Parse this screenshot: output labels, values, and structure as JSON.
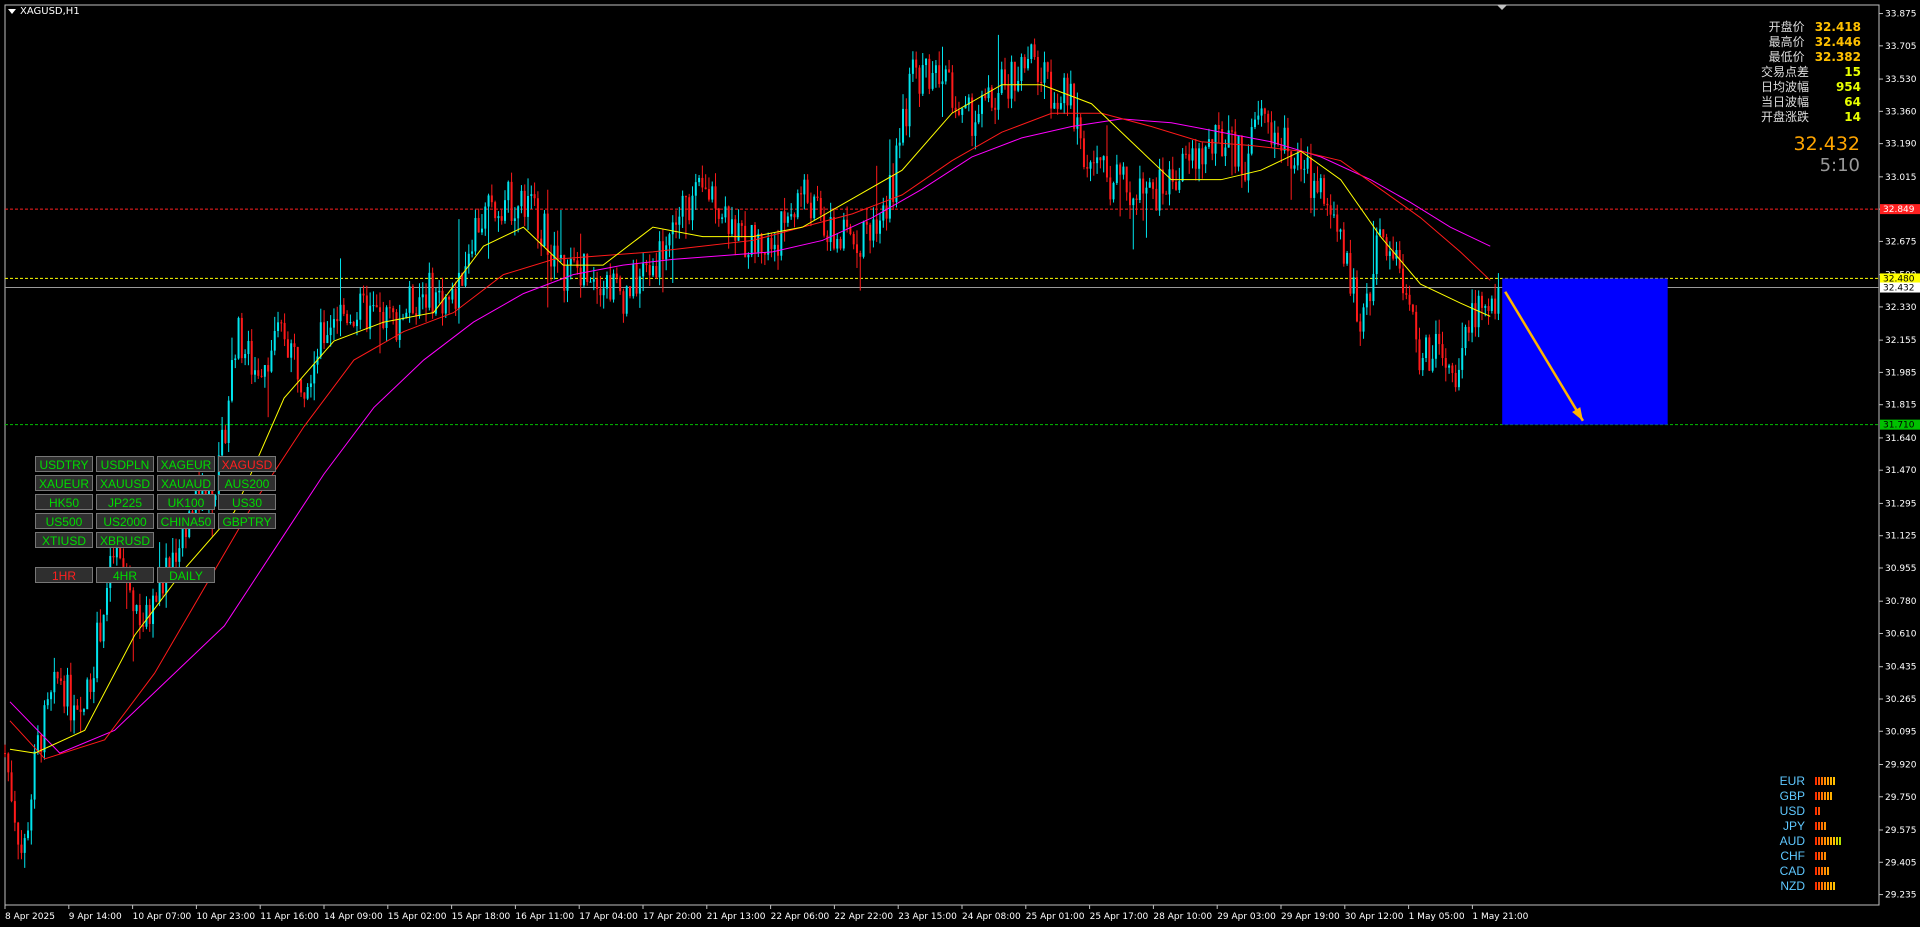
{
  "window": {
    "title": "XAGUSD,H1"
  },
  "info_panel": [
    {
      "label": "开盘价",
      "value": "32.418"
    },
    {
      "label": "最高价",
      "value": "32.446"
    },
    {
      "label": "最低价",
      "value": "32.382"
    },
    {
      "label": "交易点差",
      "value": "15"
    },
    {
      "label": "日均波幅",
      "value": "954"
    },
    {
      "label": "当日波幅",
      "value": "64"
    },
    {
      "label": "开盘涨跌",
      "value": "14"
    }
  ],
  "current_price": "32.432",
  "bar_timer": "5:10",
  "symbol_buttons": [
    {
      "label": "USDTRY",
      "active": false
    },
    {
      "label": "USDPLN",
      "active": false
    },
    {
      "label": "XAGEUR",
      "active": false
    },
    {
      "label": "XAGUSD",
      "active": true
    },
    {
      "label": "XAUEUR",
      "active": false
    },
    {
      "label": "XAUUSD",
      "active": false
    },
    {
      "label": "XAUAUD",
      "active": false
    },
    {
      "label": "AUS200",
      "active": false
    },
    {
      "label": "HK50",
      "active": false
    },
    {
      "label": "JP225",
      "active": false
    },
    {
      "label": "UK100",
      "active": false
    },
    {
      "label": "US30",
      "active": false
    },
    {
      "label": "US500",
      "active": false
    },
    {
      "label": "US2000",
      "active": false
    },
    {
      "label": "CHINA50",
      "active": false
    },
    {
      "label": "GBPTRY",
      "active": false
    },
    {
      "label": "XTIUSD",
      "active": false
    },
    {
      "label": "XBRUSD",
      "active": false
    }
  ],
  "timeframe_buttons": [
    {
      "label": "1HR",
      "active": true
    },
    {
      "label": "4HR",
      "active": false
    },
    {
      "label": "DAILY",
      "active": false
    }
  ],
  "currency_strength": [
    {
      "name": "EUR",
      "level": 7
    },
    {
      "name": "GBP",
      "level": 6
    },
    {
      "name": "USD",
      "level": 2
    },
    {
      "name": "JPY",
      "level": 4
    },
    {
      "name": "AUD",
      "level": 9
    },
    {
      "name": "CHF",
      "level": 4
    },
    {
      "name": "CAD",
      "level": 5
    },
    {
      "name": "NZD",
      "level": 7
    }
  ],
  "colors": {
    "bull": "#00e5ee",
    "bear": "#ff1a1a",
    "ma_fast": "#ffff00",
    "ma_mid": "#ff1a1a",
    "ma_slow": "#ff00ff",
    "box": "#0000ff",
    "arrow": "#ffb400",
    "resistance": "#ff2020",
    "support": "#00c000"
  },
  "chart_data": {
    "type": "candlestick",
    "symbol": "XAGUSD",
    "timeframe": "H1",
    "y_axis_ticks": [
      "33.875",
      "33.705",
      "33.530",
      "33.360",
      "33.190",
      "33.015",
      "32.845",
      "32.675",
      "32.500",
      "32.330",
      "32.155",
      "31.985",
      "31.815",
      "31.640",
      "31.470",
      "31.295",
      "31.125",
      "30.955",
      "30.780",
      "30.610",
      "30.435",
      "30.265",
      "30.095",
      "29.920",
      "29.750",
      "29.575",
      "29.405",
      "29.235"
    ],
    "ylim": [
      29.18,
      33.92
    ],
    "x_axis_ticks": [
      "8 Apr 2025",
      "9 Apr 14:00",
      "10 Apr 07:00",
      "10 Apr 23:00",
      "11 Apr 16:00",
      "14 Apr 09:00",
      "15 Apr 02:00",
      "15 Apr 18:00",
      "16 Apr 11:00",
      "17 Apr 04:00",
      "17 Apr 20:00",
      "21 Apr 13:00",
      "22 Apr 06:00",
      "22 Apr 22:00",
      "23 Apr 15:00",
      "24 Apr 08:00",
      "25 Apr 01:00",
      "25 Apr 17:00",
      "28 Apr 10:00",
      "29 Apr 03:00",
      "29 Apr 19:00",
      "30 Apr 12:00",
      "1 May 05:00",
      "1 May 21:00"
    ],
    "price_path": [
      [
        0,
        29.98
      ],
      [
        18,
        29.42
      ],
      [
        32,
        30.0
      ],
      [
        55,
        30.4
      ],
      [
        75,
        30.1
      ],
      [
        110,
        31.05
      ],
      [
        140,
        30.65
      ],
      [
        160,
        30.9
      ],
      [
        185,
        31.25
      ],
      [
        215,
        31.45
      ],
      [
        232,
        32.2
      ],
      [
        250,
        32.0
      ],
      [
        280,
        32.2
      ],
      [
        300,
        31.95
      ],
      [
        330,
        32.3
      ],
      [
        360,
        32.3
      ],
      [
        390,
        32.25
      ],
      [
        420,
        32.42
      ],
      [
        450,
        32.35
      ],
      [
        470,
        32.75
      ],
      [
        500,
        32.9
      ],
      [
        530,
        32.85
      ],
      [
        560,
        32.5
      ],
      [
        585,
        32.55
      ],
      [
        620,
        32.4
      ],
      [
        650,
        32.55
      ],
      [
        680,
        32.85
      ],
      [
        710,
        32.95
      ],
      [
        740,
        32.68
      ],
      [
        770,
        32.65
      ],
      [
        800,
        32.95
      ],
      [
        830,
        32.68
      ],
      [
        860,
        32.7
      ],
      [
        890,
        32.95
      ],
      [
        910,
        33.55
      ],
      [
        940,
        33.6
      ],
      [
        960,
        33.3
      ],
      [
        990,
        33.4
      ],
      [
        1010,
        33.55
      ],
      [
        1030,
        33.62
      ],
      [
        1045,
        33.5
      ],
      [
        1070,
        33.4
      ],
      [
        1085,
        33.1
      ],
      [
        1110,
        33.0
      ],
      [
        1140,
        32.9
      ],
      [
        1160,
        32.95
      ],
      [
        1190,
        33.1
      ],
      [
        1220,
        33.2
      ],
      [
        1245,
        33.1
      ],
      [
        1260,
        33.35
      ],
      [
        1280,
        33.2
      ],
      [
        1300,
        33.05
      ],
      [
        1320,
        32.95
      ],
      [
        1345,
        32.55
      ],
      [
        1360,
        32.25
      ],
      [
        1380,
        32.7
      ],
      [
        1400,
        32.55
      ],
      [
        1420,
        32.05
      ],
      [
        1440,
        32.1
      ],
      [
        1455,
        31.85
      ],
      [
        1470,
        32.35
      ],
      [
        1485,
        32.25
      ],
      [
        1500,
        32.43
      ]
    ],
    "ma_fast": [
      [
        5,
        30.0
      ],
      [
        30,
        29.98
      ],
      [
        80,
        30.1
      ],
      [
        130,
        30.6
      ],
      [
        180,
        30.95
      ],
      [
        230,
        31.25
      ],
      [
        280,
        31.85
      ],
      [
        330,
        32.15
      ],
      [
        380,
        32.25
      ],
      [
        430,
        32.3
      ],
      [
        480,
        32.65
      ],
      [
        520,
        32.75
      ],
      [
        560,
        32.55
      ],
      [
        600,
        32.55
      ],
      [
        650,
        32.75
      ],
      [
        700,
        32.7
      ],
      [
        750,
        32.7
      ],
      [
        800,
        32.75
      ],
      [
        850,
        32.9
      ],
      [
        900,
        33.05
      ],
      [
        950,
        33.35
      ],
      [
        1000,
        33.5
      ],
      [
        1040,
        33.5
      ],
      [
        1090,
        33.4
      ],
      [
        1130,
        33.2
      ],
      [
        1170,
        33.0
      ],
      [
        1220,
        33.0
      ],
      [
        1260,
        33.05
      ],
      [
        1300,
        33.15
      ],
      [
        1340,
        33.0
      ],
      [
        1380,
        32.7
      ],
      [
        1420,
        32.45
      ],
      [
        1460,
        32.35
      ],
      [
        1490,
        32.28
      ]
    ],
    "ma_mid": [
      [
        5,
        30.15
      ],
      [
        40,
        29.95
      ],
      [
        100,
        30.05
      ],
      [
        150,
        30.4
      ],
      [
        200,
        30.85
      ],
      [
        250,
        31.3
      ],
      [
        300,
        31.7
      ],
      [
        350,
        32.05
      ],
      [
        400,
        32.2
      ],
      [
        450,
        32.3
      ],
      [
        500,
        32.5
      ],
      [
        550,
        32.58
      ],
      [
        600,
        32.6
      ],
      [
        650,
        32.62
      ],
      [
        700,
        32.65
      ],
      [
        750,
        32.68
      ],
      [
        800,
        32.75
      ],
      [
        850,
        32.82
      ],
      [
        900,
        32.92
      ],
      [
        950,
        33.1
      ],
      [
        1000,
        33.25
      ],
      [
        1050,
        33.35
      ],
      [
        1100,
        33.35
      ],
      [
        1150,
        33.28
      ],
      [
        1200,
        33.2
      ],
      [
        1250,
        33.18
      ],
      [
        1300,
        33.15
      ],
      [
        1340,
        33.1
      ],
      [
        1380,
        32.95
      ],
      [
        1420,
        32.8
      ],
      [
        1460,
        32.62
      ],
      [
        1490,
        32.47
      ]
    ],
    "ma_slow": [
      [
        5,
        30.25
      ],
      [
        55,
        29.98
      ],
      [
        110,
        30.1
      ],
      [
        160,
        30.35
      ],
      [
        220,
        30.65
      ],
      [
        270,
        31.05
      ],
      [
        320,
        31.45
      ],
      [
        370,
        31.8
      ],
      [
        420,
        32.05
      ],
      [
        470,
        32.25
      ],
      [
        520,
        32.4
      ],
      [
        570,
        32.5
      ],
      [
        620,
        32.55
      ],
      [
        670,
        32.58
      ],
      [
        720,
        32.6
      ],
      [
        770,
        32.62
      ],
      [
        820,
        32.68
      ],
      [
        870,
        32.8
      ],
      [
        920,
        32.95
      ],
      [
        970,
        33.12
      ],
      [
        1020,
        33.22
      ],
      [
        1070,
        33.28
      ],
      [
        1120,
        33.32
      ],
      [
        1170,
        33.3
      ],
      [
        1220,
        33.25
      ],
      [
        1270,
        33.2
      ],
      [
        1320,
        33.12
      ],
      [
        1370,
        33.0
      ],
      [
        1410,
        32.88
      ],
      [
        1450,
        32.75
      ],
      [
        1490,
        32.65
      ]
    ],
    "levels": [
      {
        "price": 32.845,
        "label": "32.849",
        "color": "resistance"
      },
      {
        "price": 32.48,
        "label": "32.480",
        "color": "ma_fast"
      },
      {
        "price": 32.432,
        "label": "32.432",
        "color": "current"
      },
      {
        "price": 31.71,
        "label": "31.710",
        "color": "support"
      }
    ],
    "projection_box": {
      "t_start": 1502,
      "t_end": 1668,
      "price_top": 32.48,
      "price_bottom": 31.71
    },
    "projection_arrow": {
      "t_start": 1505,
      "price_start": 32.41,
      "t_end": 1583,
      "price_end": 31.73
    }
  }
}
